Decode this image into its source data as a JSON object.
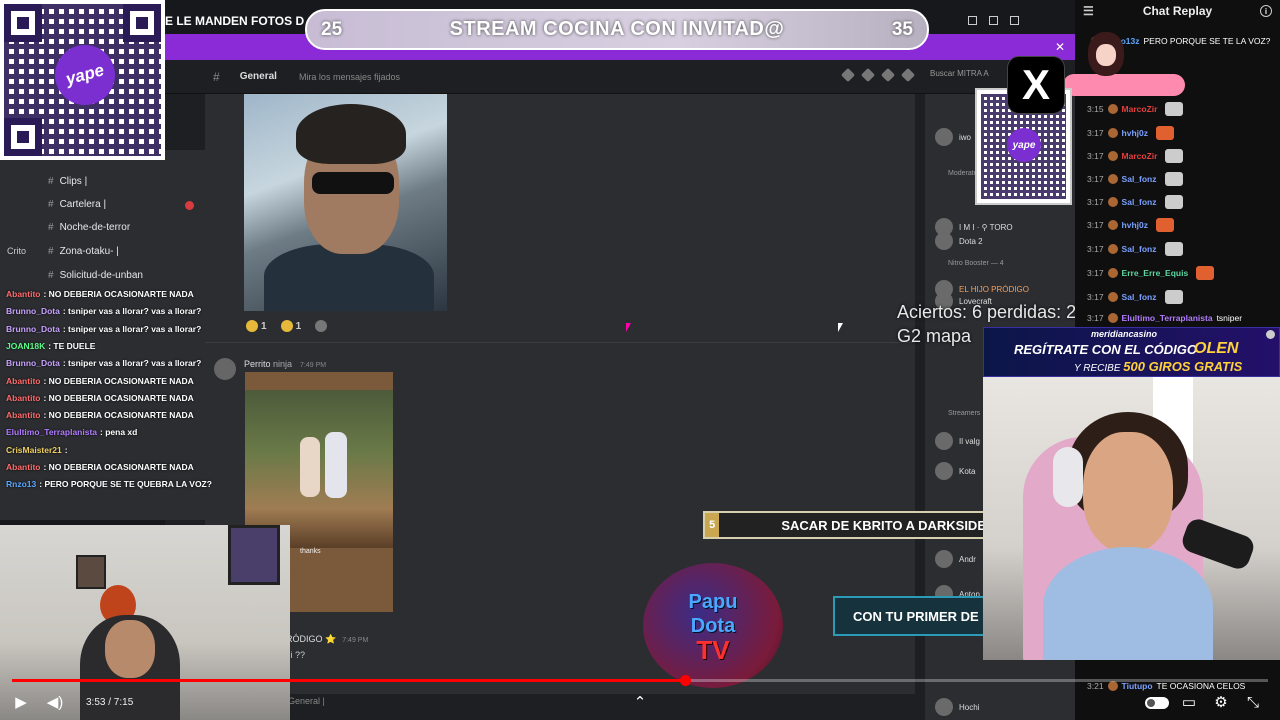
{
  "banner": {
    "left_num": "25",
    "title": "STREAM COCINA CON INVITAD@",
    "right_num": "35"
  },
  "marquee": "E LE MANDEN FOTOS D",
  "qr": {
    "logo": "yape"
  },
  "discord": {
    "channel": "General",
    "pinned_hint": "Mira los mensajes fijados",
    "search_placeholder": "Buscar MITRA A",
    "channels": [
      {
        "label": "Clips |"
      },
      {
        "label": "Cartelera |"
      },
      {
        "label": "Noche-de-terror"
      },
      {
        "label": "Zona-otaku- |"
      },
      {
        "label": "Solicitud-de-unban"
      }
    ],
    "side_labels": {
      "crito": "Crito"
    },
    "message2": {
      "author": "Perrito",
      "badge": "ninja",
      "time": "7:49 PM",
      "caption": "thanks"
    },
    "message3": {
      "author": "RÓDIGO ⭐",
      "time": "7:49 PM",
      "text": "zi ??"
    },
    "reactions": [
      {
        "count": "1"
      },
      {
        "count": "1"
      }
    ],
    "bottom_bar": "General |",
    "members": [
      {
        "name": "iwo",
        "style": ""
      },
      {
        "name": "Moderator",
        "style": "header"
      },
      {
        "name": "I M I · ⚲ TORO",
        "style": ""
      },
      {
        "name": "Dota 2",
        "style": ""
      },
      {
        "name": "Nitro Booster — 4",
        "style": "header"
      },
      {
        "name": "EL HIJO PRÓDIGO",
        "style": "orange"
      },
      {
        "name": "Lovecraft",
        "style": ""
      },
      {
        "name": "Streamers",
        "style": "header"
      },
      {
        "name": "Il valg",
        "style": ""
      },
      {
        "name": "Kota",
        "style": ""
      },
      {
        "name": "Andr",
        "style": ""
      },
      {
        "name": "Anton",
        "style": ""
      },
      {
        "name": "Hochi",
        "style": ""
      }
    ]
  },
  "overlay_chat": [
    {
      "user": "Abantito",
      "text": "NO DEBERIA OCASIONARTE NADA",
      "color": "#ff6b6b"
    },
    {
      "user": "Brunno_Dota",
      "text": "tsniper vas a llorar? vas a llorar?",
      "color": "#c9a3ff"
    },
    {
      "user": "Brunno_Dota",
      "text": "tsniper vas a llorar? vas a llorar?",
      "color": "#c9a3ff"
    },
    {
      "user": "JOAN18K",
      "text": "TE DUELE",
      "color": "#5dff8c"
    },
    {
      "user": "Brunno_Dota",
      "text": "tsniper vas a llorar? vas a llorar?",
      "color": "#c9a3ff"
    },
    {
      "user": "Abantito",
      "text": "NO DEBERIA OCASIONARTE NADA",
      "color": "#ff6b6b"
    },
    {
      "user": "Abantito",
      "text": "NO DEBERIA OCASIONARTE NADA",
      "color": "#ff6b6b"
    },
    {
      "user": "Abantito",
      "text": "NO DEBERIA OCASIONARTE NADA",
      "color": "#ff6b6b"
    },
    {
      "user": "Elultimo_Terraplanista",
      "text": "pena xd",
      "color": "#b07bff"
    },
    {
      "user": "CrisMaister21",
      "text": "",
      "color": "#f0d060"
    },
    {
      "user": "Abantito",
      "text": "NO DEBERIA OCASIONARTE NADA",
      "color": "#ff6b6b"
    },
    {
      "user": "Rnzo13",
      "text": "PERO PORQUE SE TE QUEBRA LA VOZ?",
      "color": "#5da8ff"
    }
  ],
  "aciertos": {
    "line1": "Aciertos: 6 perdidas: 2",
    "line2": "G2 mapa"
  },
  "task": {
    "num": "5",
    "text": "SACAR DE KBRITO A DARKSIDE"
  },
  "primer": "CON TU PRIMER DE",
  "papu": {
    "l1": "Papu",
    "l2": "Dota",
    "l3": "TV"
  },
  "x_logo": "X",
  "replay": {
    "title": "Chat Replay",
    "lines": [
      {
        "time": "",
        "user": "Rnzo13z",
        "text": "PERO PORQUE SE TE LA VOZ?",
        "ucolor": "#5da8ff",
        "emote": ""
      },
      {
        "time": "3:15",
        "user": "MarcoZir",
        "text": "",
        "ucolor": "#e04040",
        "emote": "g"
      },
      {
        "time": "3:17",
        "user": "hvhj0z",
        "text": "",
        "ucolor": "#7aa0ff",
        "emote": "o"
      },
      {
        "time": "3:17",
        "user": "MarcoZir",
        "text": "",
        "ucolor": "#e04040",
        "emote": "g"
      },
      {
        "time": "3:17",
        "user": "Sal_fonz",
        "text": "",
        "ucolor": "#7aa0ff",
        "emote": "g"
      },
      {
        "time": "3:17",
        "user": "Sal_fonz",
        "text": "",
        "ucolor": "#7aa0ff",
        "emote": "g"
      },
      {
        "time": "3:17",
        "user": "hvhj0z",
        "text": "",
        "ucolor": "#7aa0ff",
        "emote": "o"
      },
      {
        "time": "3:17",
        "user": "Sal_fonz",
        "text": "",
        "ucolor": "#7aa0ff",
        "emote": "g"
      },
      {
        "time": "3:17",
        "user": "Erre_Erre_Equis",
        "text": "",
        "ucolor": "#5dd6a0",
        "emote": "o"
      },
      {
        "time": "3:17",
        "user": "Sal_fonz",
        "text": "",
        "ucolor": "#7aa0ff",
        "emote": "g"
      },
      {
        "time": "3:17",
        "user": "Elultimo_Terraplanista",
        "text": "tsniper",
        "ucolor": "#b07bff",
        "emote": ""
      },
      {
        "time": "3:21",
        "user": "Tiutupo",
        "text": "TE OCASIONA CELOS",
        "ucolor": "#7aa0ff",
        "emote": ""
      }
    ]
  },
  "casino": {
    "brand": "meridiancasino",
    "line1": "REGÍTRATE CON EL CÓDIGO",
    "code": "OLEN",
    "line2a": "Y RECIBE ",
    "line2b": "500 GIROS GRATIS"
  },
  "player": {
    "time": "3:53 / 7:15",
    "progress": 0.536
  },
  "colors": {
    "accent": "#ff0000",
    "purple": "#8b2bd8"
  }
}
